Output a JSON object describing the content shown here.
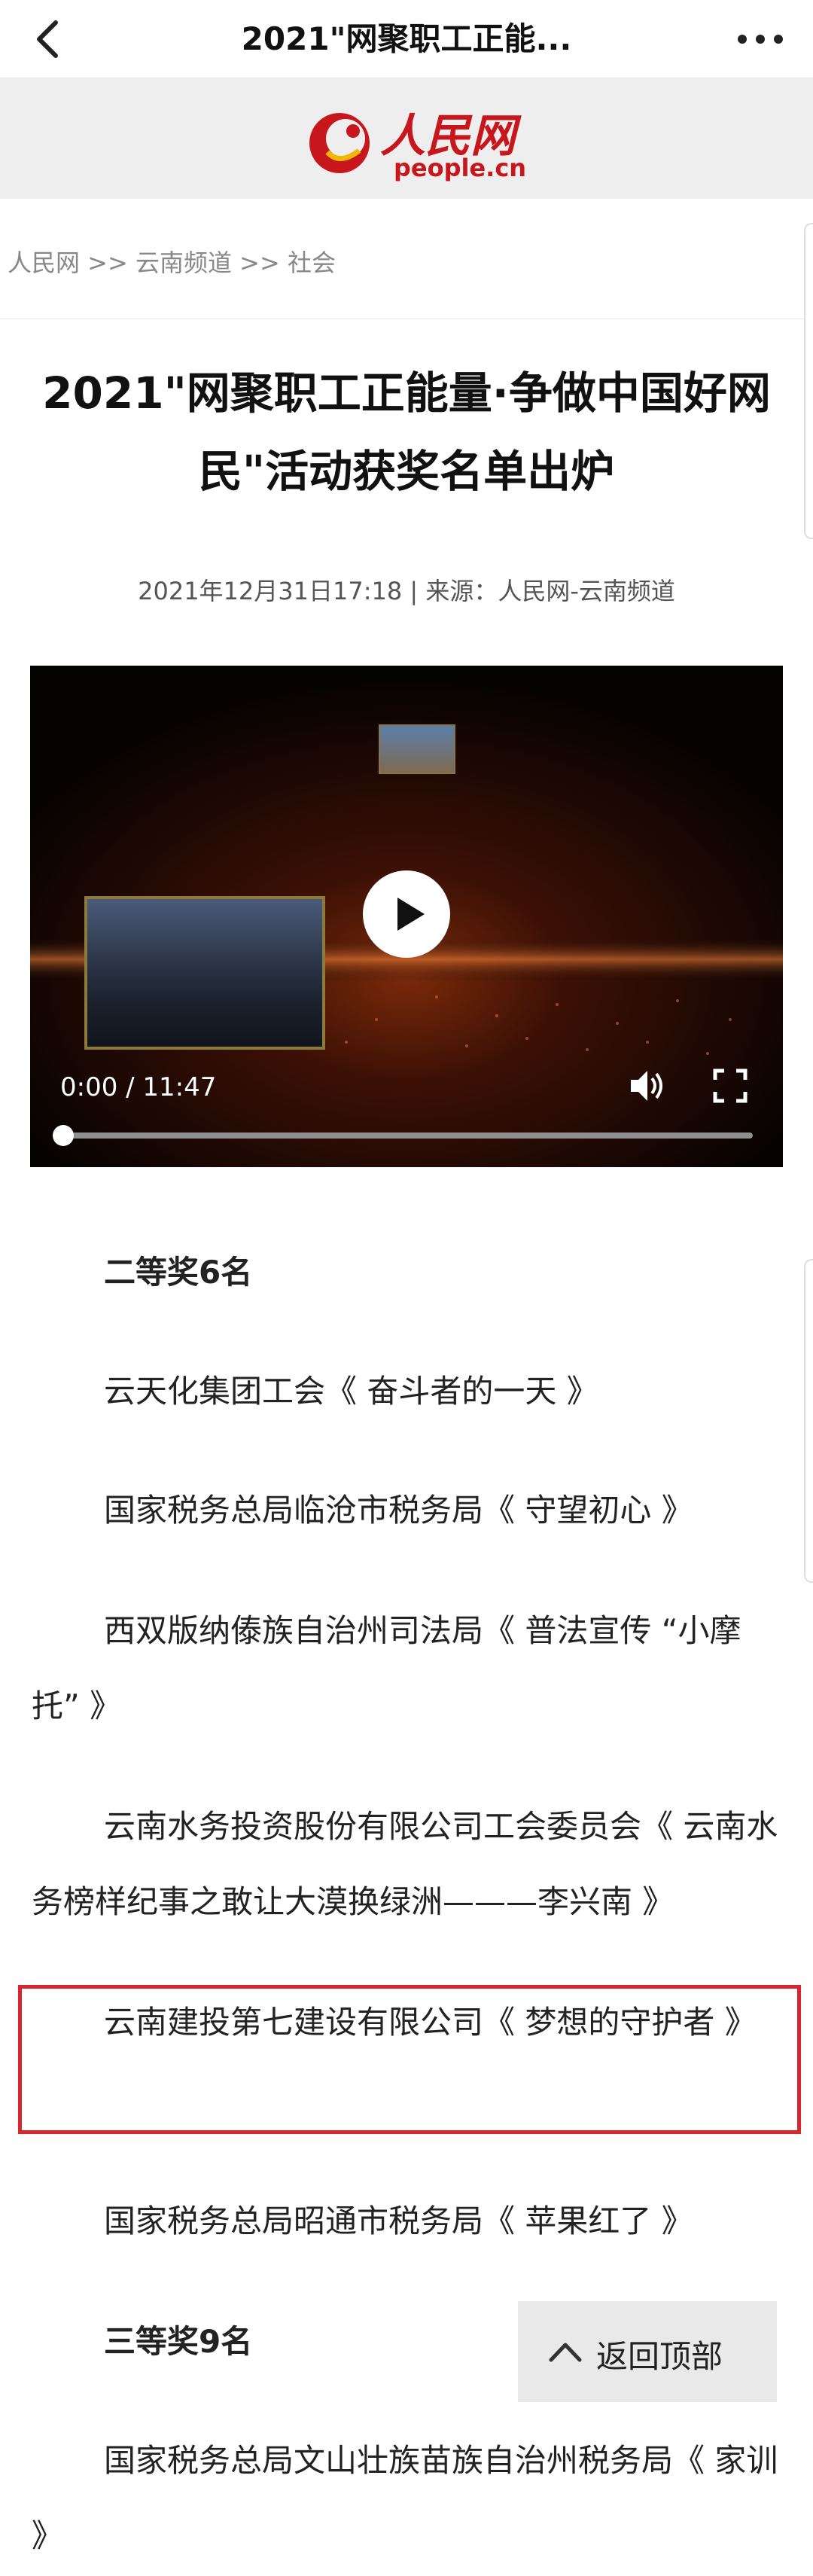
{
  "header": {
    "title": "2021\"网聚职工正能...",
    "back_icon": "chevron-left-icon",
    "more_icon": "more-dots-icon"
  },
  "logo": {
    "text_cn": "人民网",
    "text_en": "people.cn",
    "brand_color": "#c8161d"
  },
  "breadcrumb": "人民网 >> 云南频道 >> 社会",
  "article": {
    "headline": "2021\"网聚职工正能量·争做中国好网民\"活动获奖名单出炉",
    "meta": "2021年12月31日17:18 | 来源：人民网-云南频道"
  },
  "video": {
    "time": "0:00 / 11:47",
    "progress": 0,
    "play_icon": "play-icon",
    "volume_icon": "volume-icon",
    "fullscreen_icon": "fullscreen-icon"
  },
  "content": {
    "paragraphs": [
      "二等奖6名",
      "云天化集团工会《 奋斗者的一天 》",
      "国家税务总局临沧市税务局《 守望初心 》",
      "西双版纳傣族自治州司法局《 普法宣传 “小摩托” 》",
      "云南水务投资股份有限公司工会委员会《 云南水务榜样纪事之敢让大漠换绿洲———李兴南 》",
      "云南建投第七建设有限公司《 梦想的守护者 》",
      "国家税务总局昭通市税务局《 苹果红了 》",
      "三等奖9名",
      "国家税务总局文山壮族苗族自治州税务局《 家训 》"
    ]
  },
  "back_to_top": {
    "label": "返回顶部",
    "icon": "chevron-up-icon"
  },
  "colors": {
    "highlight_border": "#d7262d",
    "logo_red": "#c8161d"
  }
}
